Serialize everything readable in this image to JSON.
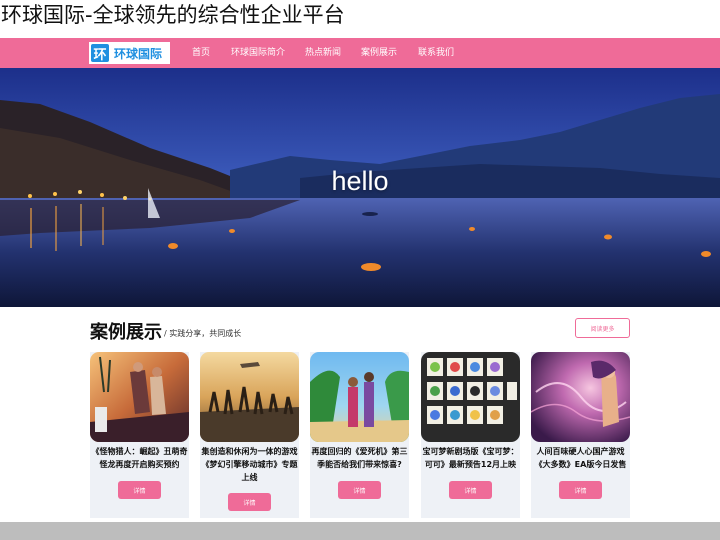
{
  "page": {
    "heading": "环球国际-全球领先的综合性企业平台"
  },
  "nav": {
    "logo_mark": "环",
    "logo_text": "环球国际",
    "items": [
      "首页",
      "环球国际简介",
      "热点新闻",
      "案例展示",
      "联系我们"
    ]
  },
  "hero": {
    "text": "hello"
  },
  "cases": {
    "title": "案例展示",
    "subtitle": "/ 实践分享，共同成长",
    "more_label": "阅读更多",
    "cards": [
      {
        "title": "《怪物猎人：崛起》丑萌奇怪龙再度开启购买预约",
        "button": "详情"
      },
      {
        "title": "集创造和休闲为一体的游戏《梦幻引擎移动城市》专题上线",
        "button": "详情"
      },
      {
        "title": "再度回归的《爱死机》第三季能否给我们带来惊喜?",
        "button": "详情"
      },
      {
        "title": "宝可梦新剧场版《宝可梦：可可》最新预告12月上映",
        "button": "详情"
      },
      {
        "title": "人间百味硬人心国产游戏《大多数》EA版今日发售",
        "button": "详情"
      }
    ]
  },
  "colors": {
    "brand_pink": "#ef6b98",
    "logo_blue": "#1f8fe0",
    "card_bg": "#eef1f6",
    "footer_gray": "#bdbdbd"
  }
}
